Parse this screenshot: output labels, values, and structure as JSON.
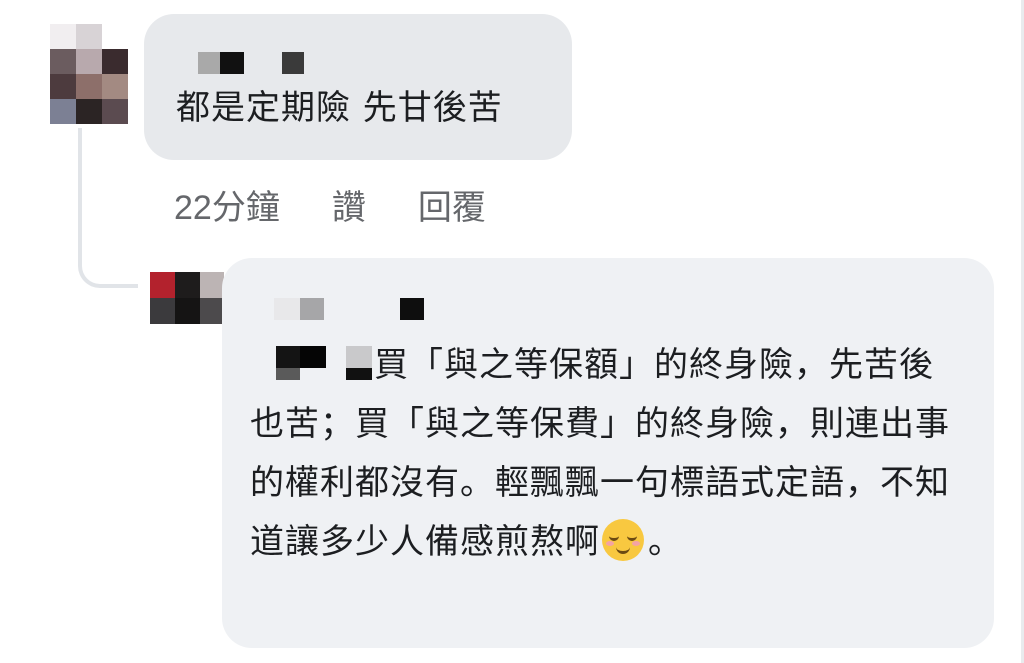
{
  "comments": [
    {
      "text": "都是定期險 先甘後苦",
      "actions": {
        "timestamp": "22分鐘",
        "like": "讚",
        "reply": "回覆"
      }
    }
  ],
  "replies": [
    {
      "text": "買「與之等保額」的終身險，先苦後也苦；買「與之等保費」的終身險，則連出事的權利都沒有。輕飄飄一句標語式定語，不知道讓多少人備感煎熬啊",
      "text_after_emoji": "。",
      "emoji": "relieved-face"
    }
  ],
  "colors": {
    "bubble_primary": "#e7e9ec",
    "bubble_reply": "#eff1f4",
    "text": "#1c1e21",
    "meta_text": "#65676b",
    "thread_line": "#e1e4e8"
  }
}
